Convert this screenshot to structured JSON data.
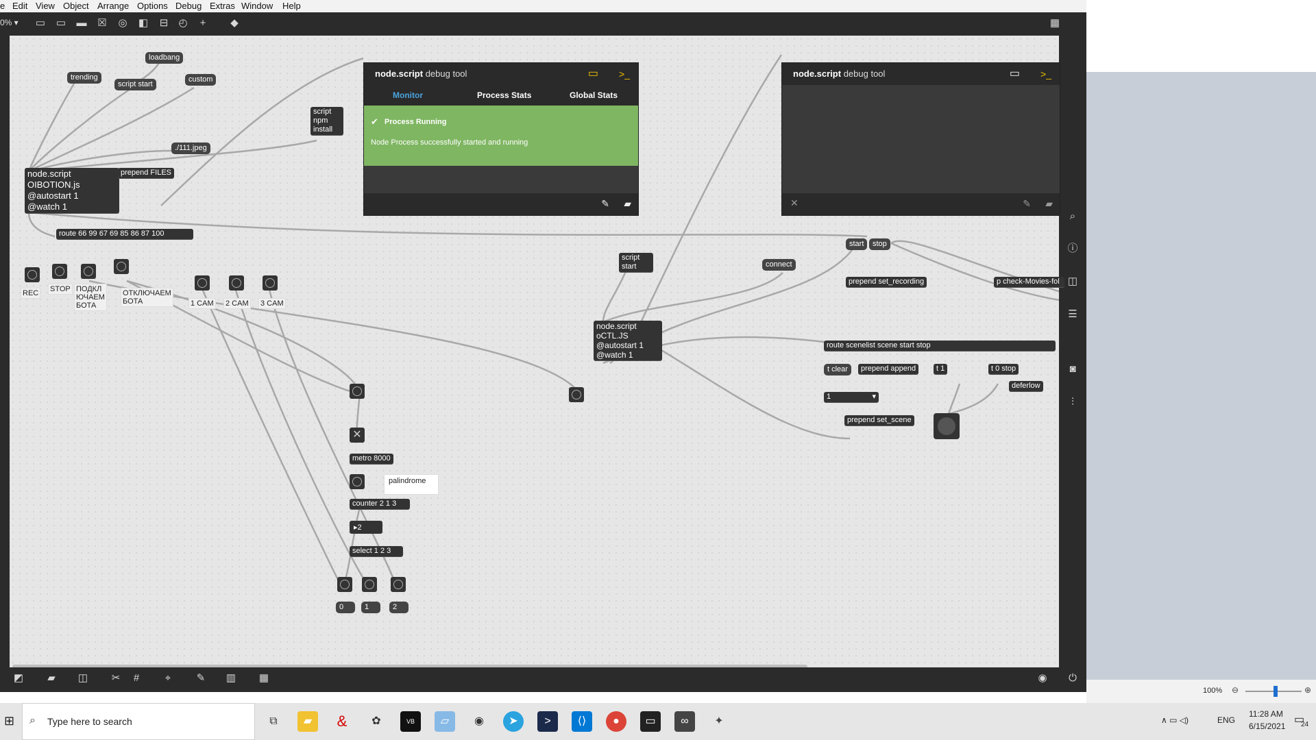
{
  "menu": [
    "e",
    "Edit",
    "View",
    "Object",
    "Arrange",
    "Options",
    "Debug",
    "Extras",
    "Window",
    "Help"
  ],
  "toolbar": {
    "zoom": "0%"
  },
  "objects": {
    "loadbang": "loadbang",
    "trending": "trending",
    "script_start": "script start",
    "custom": "custom",
    "script_npm": "script\nnpm\ninstall",
    "jpeg": "./111.jpeg",
    "node1": "node.script\nOIBOTION.js\n@autostart 1\n@watch 1",
    "prepend_files": "prepend FILES",
    "route": "route 66 99 67 69 85 86 87 100",
    "rec": "REC",
    "stop": "STOP",
    "podkl": "ПОДКЛ\nЮЧАЕМ\nБОТА",
    "otkl": "ОТКЛЮЧАЕМ\nБОТА",
    "cam1": "1 CAM",
    "cam2": "2 CAM",
    "cam3": "3 CAM",
    "metro": "metro 8000",
    "palindrome": "palindrome",
    "counter": "counter 2 1 3",
    "numval": "2",
    "select": "select 1 2 3",
    "m0": "0",
    "m1": "1",
    "m2": "2",
    "script_start2": "script\nstart",
    "connect": "connect",
    "node2": "node.script\noCTL.JS\n@autostart 1\n@watch 1",
    "start": "start",
    "stop2": "stop",
    "prepend_rec": "prepend set_recording",
    "p_check": "p check-Movies-fol",
    "route2": "route scenelist scene start stop",
    "tclear": "t clear",
    "prepend_append": "prepend append",
    "t1": "t 1",
    "t0stop": "t 0 stop",
    "deferlow": "deferlow",
    "menu_val": "1",
    "prepend_scene": "prepend set_scene"
  },
  "debug1": {
    "title_bold": "node.script",
    "title_rest": "debug tool",
    "tabs": [
      "Monitor",
      "Process Stats",
      "Global Stats"
    ],
    "status_title": "Process Running",
    "status_msg": "Node Process successfully started and running"
  },
  "debug2": {
    "title_bold": "node.script",
    "title_rest": "debug tool"
  },
  "statusbar": {
    "zoom": "100%"
  },
  "taskbar": {
    "search_placeholder": "Type here to search",
    "lang": "ENG",
    "time": "11:28 AM",
    "date": "6/15/2021",
    "notif": "24"
  },
  "colors": {
    "canvas": "#e6e6e6",
    "object": "#333333",
    "status_green": "#7fb662",
    "tab_active": "#4aa3df"
  }
}
